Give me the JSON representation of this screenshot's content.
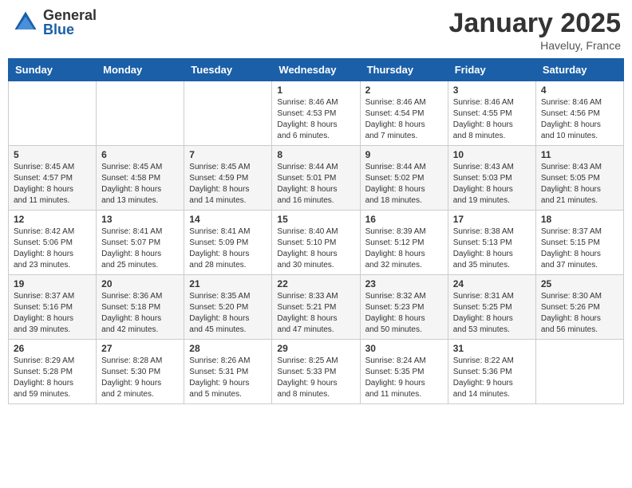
{
  "logo": {
    "general": "General",
    "blue": "Blue"
  },
  "title": "January 2025",
  "location": "Haveluy, France",
  "days_of_week": [
    "Sunday",
    "Monday",
    "Tuesday",
    "Wednesday",
    "Thursday",
    "Friday",
    "Saturday"
  ],
  "weeks": [
    [
      {
        "day": "",
        "info": ""
      },
      {
        "day": "",
        "info": ""
      },
      {
        "day": "",
        "info": ""
      },
      {
        "day": "1",
        "info": "Sunrise: 8:46 AM\nSunset: 4:53 PM\nDaylight: 8 hours\nand 6 minutes."
      },
      {
        "day": "2",
        "info": "Sunrise: 8:46 AM\nSunset: 4:54 PM\nDaylight: 8 hours\nand 7 minutes."
      },
      {
        "day": "3",
        "info": "Sunrise: 8:46 AM\nSunset: 4:55 PM\nDaylight: 8 hours\nand 8 minutes."
      },
      {
        "day": "4",
        "info": "Sunrise: 8:46 AM\nSunset: 4:56 PM\nDaylight: 8 hours\nand 10 minutes."
      }
    ],
    [
      {
        "day": "5",
        "info": "Sunrise: 8:45 AM\nSunset: 4:57 PM\nDaylight: 8 hours\nand 11 minutes."
      },
      {
        "day": "6",
        "info": "Sunrise: 8:45 AM\nSunset: 4:58 PM\nDaylight: 8 hours\nand 13 minutes."
      },
      {
        "day": "7",
        "info": "Sunrise: 8:45 AM\nSunset: 4:59 PM\nDaylight: 8 hours\nand 14 minutes."
      },
      {
        "day": "8",
        "info": "Sunrise: 8:44 AM\nSunset: 5:01 PM\nDaylight: 8 hours\nand 16 minutes."
      },
      {
        "day": "9",
        "info": "Sunrise: 8:44 AM\nSunset: 5:02 PM\nDaylight: 8 hours\nand 18 minutes."
      },
      {
        "day": "10",
        "info": "Sunrise: 8:43 AM\nSunset: 5:03 PM\nDaylight: 8 hours\nand 19 minutes."
      },
      {
        "day": "11",
        "info": "Sunrise: 8:43 AM\nSunset: 5:05 PM\nDaylight: 8 hours\nand 21 minutes."
      }
    ],
    [
      {
        "day": "12",
        "info": "Sunrise: 8:42 AM\nSunset: 5:06 PM\nDaylight: 8 hours\nand 23 minutes."
      },
      {
        "day": "13",
        "info": "Sunrise: 8:41 AM\nSunset: 5:07 PM\nDaylight: 8 hours\nand 25 minutes."
      },
      {
        "day": "14",
        "info": "Sunrise: 8:41 AM\nSunset: 5:09 PM\nDaylight: 8 hours\nand 28 minutes."
      },
      {
        "day": "15",
        "info": "Sunrise: 8:40 AM\nSunset: 5:10 PM\nDaylight: 8 hours\nand 30 minutes."
      },
      {
        "day": "16",
        "info": "Sunrise: 8:39 AM\nSunset: 5:12 PM\nDaylight: 8 hours\nand 32 minutes."
      },
      {
        "day": "17",
        "info": "Sunrise: 8:38 AM\nSunset: 5:13 PM\nDaylight: 8 hours\nand 35 minutes."
      },
      {
        "day": "18",
        "info": "Sunrise: 8:37 AM\nSunset: 5:15 PM\nDaylight: 8 hours\nand 37 minutes."
      }
    ],
    [
      {
        "day": "19",
        "info": "Sunrise: 8:37 AM\nSunset: 5:16 PM\nDaylight: 8 hours\nand 39 minutes."
      },
      {
        "day": "20",
        "info": "Sunrise: 8:36 AM\nSunset: 5:18 PM\nDaylight: 8 hours\nand 42 minutes."
      },
      {
        "day": "21",
        "info": "Sunrise: 8:35 AM\nSunset: 5:20 PM\nDaylight: 8 hours\nand 45 minutes."
      },
      {
        "day": "22",
        "info": "Sunrise: 8:33 AM\nSunset: 5:21 PM\nDaylight: 8 hours\nand 47 minutes."
      },
      {
        "day": "23",
        "info": "Sunrise: 8:32 AM\nSunset: 5:23 PM\nDaylight: 8 hours\nand 50 minutes."
      },
      {
        "day": "24",
        "info": "Sunrise: 8:31 AM\nSunset: 5:25 PM\nDaylight: 8 hours\nand 53 minutes."
      },
      {
        "day": "25",
        "info": "Sunrise: 8:30 AM\nSunset: 5:26 PM\nDaylight: 8 hours\nand 56 minutes."
      }
    ],
    [
      {
        "day": "26",
        "info": "Sunrise: 8:29 AM\nSunset: 5:28 PM\nDaylight: 8 hours\nand 59 minutes."
      },
      {
        "day": "27",
        "info": "Sunrise: 8:28 AM\nSunset: 5:30 PM\nDaylight: 9 hours\nand 2 minutes."
      },
      {
        "day": "28",
        "info": "Sunrise: 8:26 AM\nSunset: 5:31 PM\nDaylight: 9 hours\nand 5 minutes."
      },
      {
        "day": "29",
        "info": "Sunrise: 8:25 AM\nSunset: 5:33 PM\nDaylight: 9 hours\nand 8 minutes."
      },
      {
        "day": "30",
        "info": "Sunrise: 8:24 AM\nSunset: 5:35 PM\nDaylight: 9 hours\nand 11 minutes."
      },
      {
        "day": "31",
        "info": "Sunrise: 8:22 AM\nSunset: 5:36 PM\nDaylight: 9 hours\nand 14 minutes."
      },
      {
        "day": "",
        "info": ""
      }
    ]
  ]
}
